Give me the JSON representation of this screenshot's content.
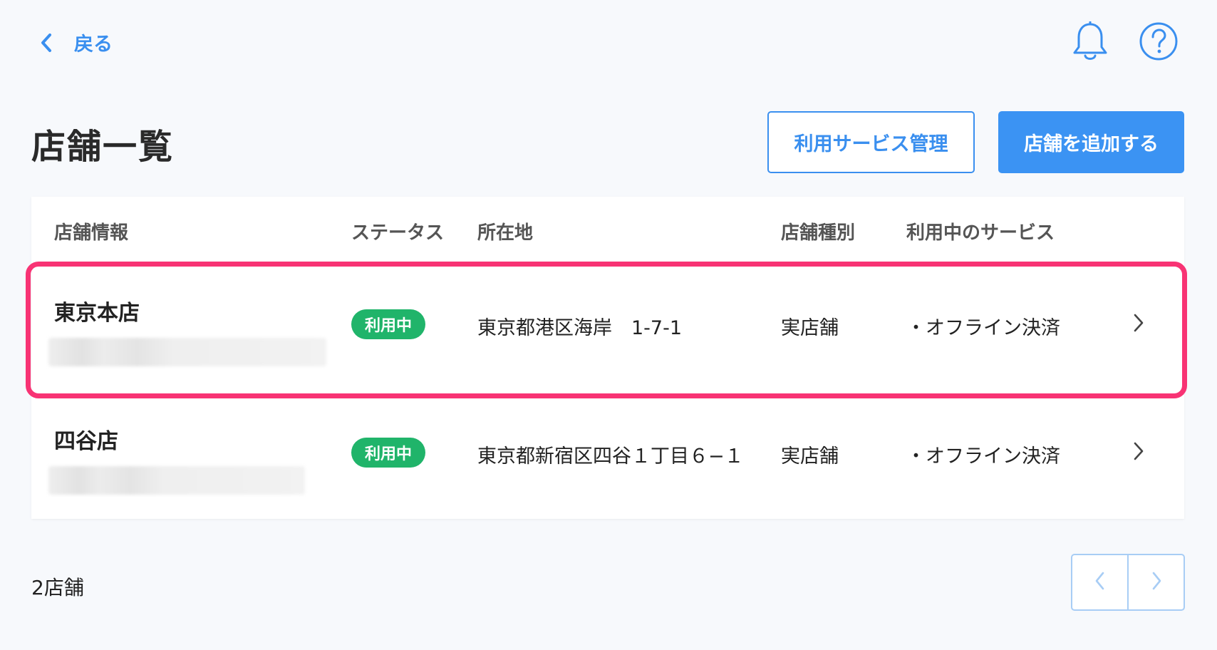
{
  "nav": {
    "back_label": "戻る"
  },
  "header": {
    "title": "店舗一覧",
    "manage_services_label": "利用サービス管理",
    "add_store_label": "店舗を追加する"
  },
  "table": {
    "columns": [
      "店舗情報",
      "ステータス",
      "所在地",
      "店舗種別",
      "利用中のサービス"
    ],
    "rows": [
      {
        "name": "東京本店",
        "status": "利用中",
        "address": "東京都港区海岸　1-7-1",
        "type": "実店舗",
        "services": "・オフライン決済"
      },
      {
        "name": "四谷店",
        "status": "利用中",
        "address": "東京都新宿区四谷１丁目６−１",
        "type": "実店舗",
        "services": "・オフライン決済"
      }
    ]
  },
  "footer": {
    "count_label": "2店舗"
  },
  "colors": {
    "accent": "#3a8fef",
    "status_active": "#20b46a",
    "highlight": "#f83374"
  }
}
